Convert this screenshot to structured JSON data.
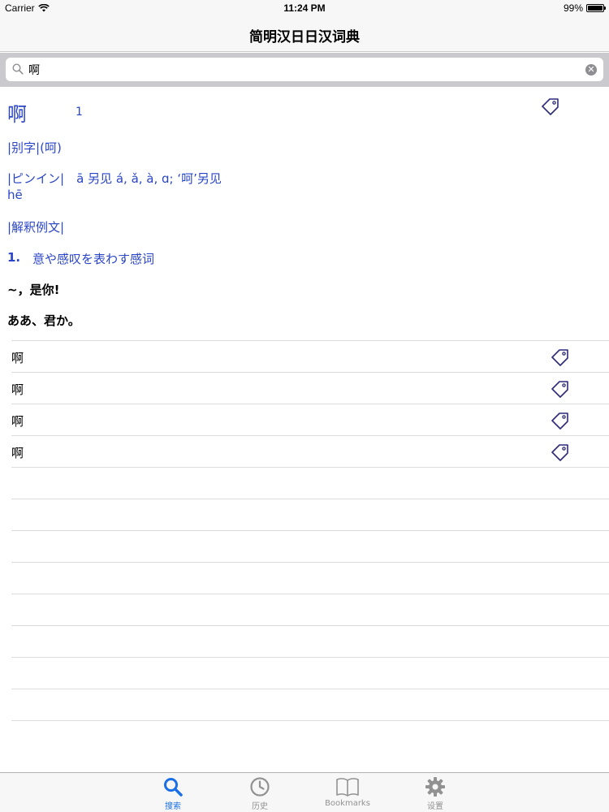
{
  "status_bar": {
    "carrier": "Carrier",
    "time": "11:24 PM",
    "battery": "99%",
    "battery_level": 0.99
  },
  "nav": {
    "title": "简明汉日日汉词典"
  },
  "search": {
    "value": "啊",
    "placeholder": ""
  },
  "entry": {
    "headword": "啊",
    "number": "1",
    "variant_line": "|别字|(呵)",
    "pinyin_line": "|ピンイン|　ā 另见 á, ǎ, à, ɑ; ‘呵’另见",
    "pinyin_line2": "hē",
    "explanation_header": "|解釈例文|",
    "sense_number": "1.",
    "sense_text": "意や感叹を表わす感词",
    "example_cn": "~，是你!",
    "example_jp": "ああ、君か。"
  },
  "results": [
    {
      "word": "啊"
    },
    {
      "word": "啊"
    },
    {
      "word": "啊"
    },
    {
      "word": "啊"
    }
  ],
  "tabs": [
    {
      "label": "搜索",
      "icon": "search-icon",
      "active": true
    },
    {
      "label": "历史",
      "icon": "clock-icon",
      "active": false
    },
    {
      "label": "Bookmarks",
      "icon": "book-icon",
      "active": false
    },
    {
      "label": "设置",
      "icon": "gear-icon",
      "active": false
    }
  ],
  "colors": {
    "accent": "#1a6fe6",
    "entry_blue": "#2a45c8",
    "tag_outline": "#2d2a7a"
  }
}
